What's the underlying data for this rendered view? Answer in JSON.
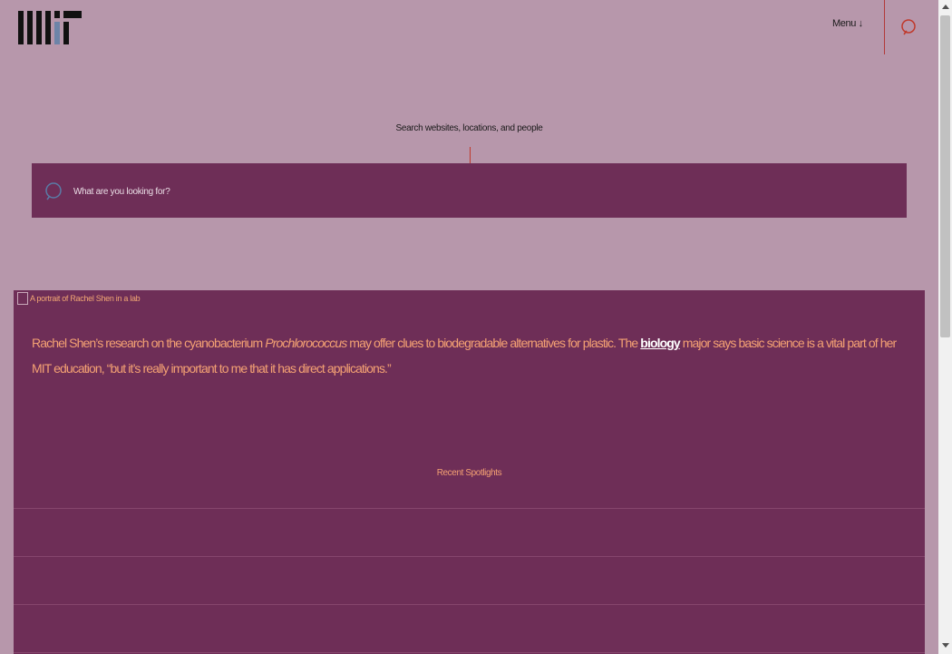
{
  "header": {
    "logo_alt": "MIT",
    "menu_label": "Menu ↓",
    "search_icon": "search-icon"
  },
  "search": {
    "heading": "Search websites, locations, and people",
    "placeholder": "What are you looking for?",
    "value": ""
  },
  "spotlight": {
    "image_alt": "A portrait of Rachel Shen in a lab",
    "caption_part1": "Rachel Shen’s research on the cyanobacterium ",
    "caption_italic": "Prochlorococcus",
    "caption_part2": " may offer clues to biodegradable alternatives for plastic. The ",
    "caption_link": "biology",
    "caption_part3": " major says basic science is a vital part of her MIT education, “but it’s really important to me that it has direct applications.”",
    "recent_label": "Recent Spotlights"
  },
  "colors": {
    "page_bg": "#b797ab",
    "panel_bg": "#6e2e57",
    "accent_text": "#f4a173",
    "logo_dark": "#1a1a1a",
    "logo_blue": "#6d84a8"
  }
}
